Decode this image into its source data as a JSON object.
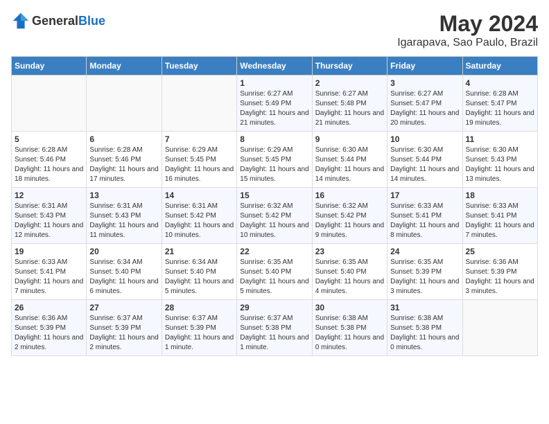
{
  "header": {
    "logo_general": "General",
    "logo_blue": "Blue",
    "month": "May 2024",
    "location": "Igarapava, Sao Paulo, Brazil"
  },
  "weekdays": [
    "Sunday",
    "Monday",
    "Tuesday",
    "Wednesday",
    "Thursday",
    "Friday",
    "Saturday"
  ],
  "weeks": [
    [
      {
        "day": "",
        "sunrise": "",
        "sunset": "",
        "daylight": ""
      },
      {
        "day": "",
        "sunrise": "",
        "sunset": "",
        "daylight": ""
      },
      {
        "day": "",
        "sunrise": "",
        "sunset": "",
        "daylight": ""
      },
      {
        "day": "1",
        "sunrise": "Sunrise: 6:27 AM",
        "sunset": "Sunset: 5:49 PM",
        "daylight": "Daylight: 11 hours and 21 minutes."
      },
      {
        "day": "2",
        "sunrise": "Sunrise: 6:27 AM",
        "sunset": "Sunset: 5:48 PM",
        "daylight": "Daylight: 11 hours and 21 minutes."
      },
      {
        "day": "3",
        "sunrise": "Sunrise: 6:27 AM",
        "sunset": "Sunset: 5:47 PM",
        "daylight": "Daylight: 11 hours and 20 minutes."
      },
      {
        "day": "4",
        "sunrise": "Sunrise: 6:28 AM",
        "sunset": "Sunset: 5:47 PM",
        "daylight": "Daylight: 11 hours and 19 minutes."
      }
    ],
    [
      {
        "day": "5",
        "sunrise": "Sunrise: 6:28 AM",
        "sunset": "Sunset: 5:46 PM",
        "daylight": "Daylight: 11 hours and 18 minutes."
      },
      {
        "day": "6",
        "sunrise": "Sunrise: 6:28 AM",
        "sunset": "Sunset: 5:46 PM",
        "daylight": "Daylight: 11 hours and 17 minutes."
      },
      {
        "day": "7",
        "sunrise": "Sunrise: 6:29 AM",
        "sunset": "Sunset: 5:45 PM",
        "daylight": "Daylight: 11 hours and 16 minutes."
      },
      {
        "day": "8",
        "sunrise": "Sunrise: 6:29 AM",
        "sunset": "Sunset: 5:45 PM",
        "daylight": "Daylight: 11 hours and 15 minutes."
      },
      {
        "day": "9",
        "sunrise": "Sunrise: 6:30 AM",
        "sunset": "Sunset: 5:44 PM",
        "daylight": "Daylight: 11 hours and 14 minutes."
      },
      {
        "day": "10",
        "sunrise": "Sunrise: 6:30 AM",
        "sunset": "Sunset: 5:44 PM",
        "daylight": "Daylight: 11 hours and 14 minutes."
      },
      {
        "day": "11",
        "sunrise": "Sunrise: 6:30 AM",
        "sunset": "Sunset: 5:43 PM",
        "daylight": "Daylight: 11 hours and 13 minutes."
      }
    ],
    [
      {
        "day": "12",
        "sunrise": "Sunrise: 6:31 AM",
        "sunset": "Sunset: 5:43 PM",
        "daylight": "Daylight: 11 hours and 12 minutes."
      },
      {
        "day": "13",
        "sunrise": "Sunrise: 6:31 AM",
        "sunset": "Sunset: 5:43 PM",
        "daylight": "Daylight: 11 hours and 11 minutes."
      },
      {
        "day": "14",
        "sunrise": "Sunrise: 6:31 AM",
        "sunset": "Sunset: 5:42 PM",
        "daylight": "Daylight: 11 hours and 10 minutes."
      },
      {
        "day": "15",
        "sunrise": "Sunrise: 6:32 AM",
        "sunset": "Sunset: 5:42 PM",
        "daylight": "Daylight: 11 hours and 10 minutes."
      },
      {
        "day": "16",
        "sunrise": "Sunrise: 6:32 AM",
        "sunset": "Sunset: 5:42 PM",
        "daylight": "Daylight: 11 hours and 9 minutes."
      },
      {
        "day": "17",
        "sunrise": "Sunrise: 6:33 AM",
        "sunset": "Sunset: 5:41 PM",
        "daylight": "Daylight: 11 hours and 8 minutes."
      },
      {
        "day": "18",
        "sunrise": "Sunrise: 6:33 AM",
        "sunset": "Sunset: 5:41 PM",
        "daylight": "Daylight: 11 hours and 7 minutes."
      }
    ],
    [
      {
        "day": "19",
        "sunrise": "Sunrise: 6:33 AM",
        "sunset": "Sunset: 5:41 PM",
        "daylight": "Daylight: 11 hours and 7 minutes."
      },
      {
        "day": "20",
        "sunrise": "Sunrise: 6:34 AM",
        "sunset": "Sunset: 5:40 PM",
        "daylight": "Daylight: 11 hours and 6 minutes."
      },
      {
        "day": "21",
        "sunrise": "Sunrise: 6:34 AM",
        "sunset": "Sunset: 5:40 PM",
        "daylight": "Daylight: 11 hours and 5 minutes."
      },
      {
        "day": "22",
        "sunrise": "Sunrise: 6:35 AM",
        "sunset": "Sunset: 5:40 PM",
        "daylight": "Daylight: 11 hours and 5 minutes."
      },
      {
        "day": "23",
        "sunrise": "Sunrise: 6:35 AM",
        "sunset": "Sunset: 5:40 PM",
        "daylight": "Daylight: 11 hours and 4 minutes."
      },
      {
        "day": "24",
        "sunrise": "Sunrise: 6:35 AM",
        "sunset": "Sunset: 5:39 PM",
        "daylight": "Daylight: 11 hours and 3 minutes."
      },
      {
        "day": "25",
        "sunrise": "Sunrise: 6:36 AM",
        "sunset": "Sunset: 5:39 PM",
        "daylight": "Daylight: 11 hours and 3 minutes."
      }
    ],
    [
      {
        "day": "26",
        "sunrise": "Sunrise: 6:36 AM",
        "sunset": "Sunset: 5:39 PM",
        "daylight": "Daylight: 11 hours and 2 minutes."
      },
      {
        "day": "27",
        "sunrise": "Sunrise: 6:37 AM",
        "sunset": "Sunset: 5:39 PM",
        "daylight": "Daylight: 11 hours and 2 minutes."
      },
      {
        "day": "28",
        "sunrise": "Sunrise: 6:37 AM",
        "sunset": "Sunset: 5:39 PM",
        "daylight": "Daylight: 11 hours and 1 minute."
      },
      {
        "day": "29",
        "sunrise": "Sunrise: 6:37 AM",
        "sunset": "Sunset: 5:38 PM",
        "daylight": "Daylight: 11 hours and 1 minute."
      },
      {
        "day": "30",
        "sunrise": "Sunrise: 6:38 AM",
        "sunset": "Sunset: 5:38 PM",
        "daylight": "Daylight: 11 hours and 0 minutes."
      },
      {
        "day": "31",
        "sunrise": "Sunrise: 6:38 AM",
        "sunset": "Sunset: 5:38 PM",
        "daylight": "Daylight: 11 hours and 0 minutes."
      },
      {
        "day": "",
        "sunrise": "",
        "sunset": "",
        "daylight": ""
      }
    ]
  ]
}
